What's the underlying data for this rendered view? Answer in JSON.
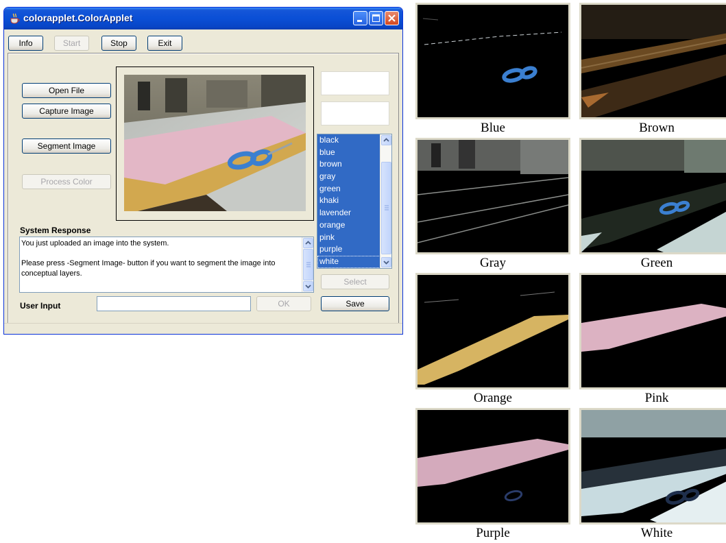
{
  "window": {
    "title": "colorapplet.ColorApplet",
    "toolbar": {
      "info": "Info",
      "start": "Start",
      "stop": "Stop",
      "exit": "Exit"
    }
  },
  "left_buttons": {
    "open_file": "Open File",
    "capture_image": "Capture Image",
    "segment_image": "Segment Image",
    "process_color": "Process Color"
  },
  "color_list": {
    "items": [
      "black",
      "blue",
      "brown",
      "gray",
      "green",
      "khaki",
      "lavender",
      "orange",
      "pink",
      "purple",
      "white"
    ],
    "selected": "white"
  },
  "select_button": "Select",
  "save_button": "Save",
  "system_response": {
    "label": "System Response",
    "lines": [
      "You just uploaded an image into the system.",
      "",
      "Please press -Segment Image- button if you want to segment the image into",
      "conceptual layers."
    ]
  },
  "user_input": {
    "label": "User Input",
    "value": "",
    "ok_label": "OK"
  },
  "thumbnails": [
    {
      "caption": "Blue"
    },
    {
      "caption": "Brown"
    },
    {
      "caption": "Gray"
    },
    {
      "caption": "Green"
    },
    {
      "caption": "Orange"
    },
    {
      "caption": "Pink"
    },
    {
      "caption": "Purple"
    },
    {
      "caption": "White"
    }
  ],
  "colors": {
    "title_bar": "#0a4fd6",
    "window_bg": "#ece9d8",
    "list_selection": "#316ac5",
    "scissors_blue": "#3b7fd0",
    "paper_pink": "#e6b6c6",
    "paper_yellow": "#d8b15a"
  }
}
